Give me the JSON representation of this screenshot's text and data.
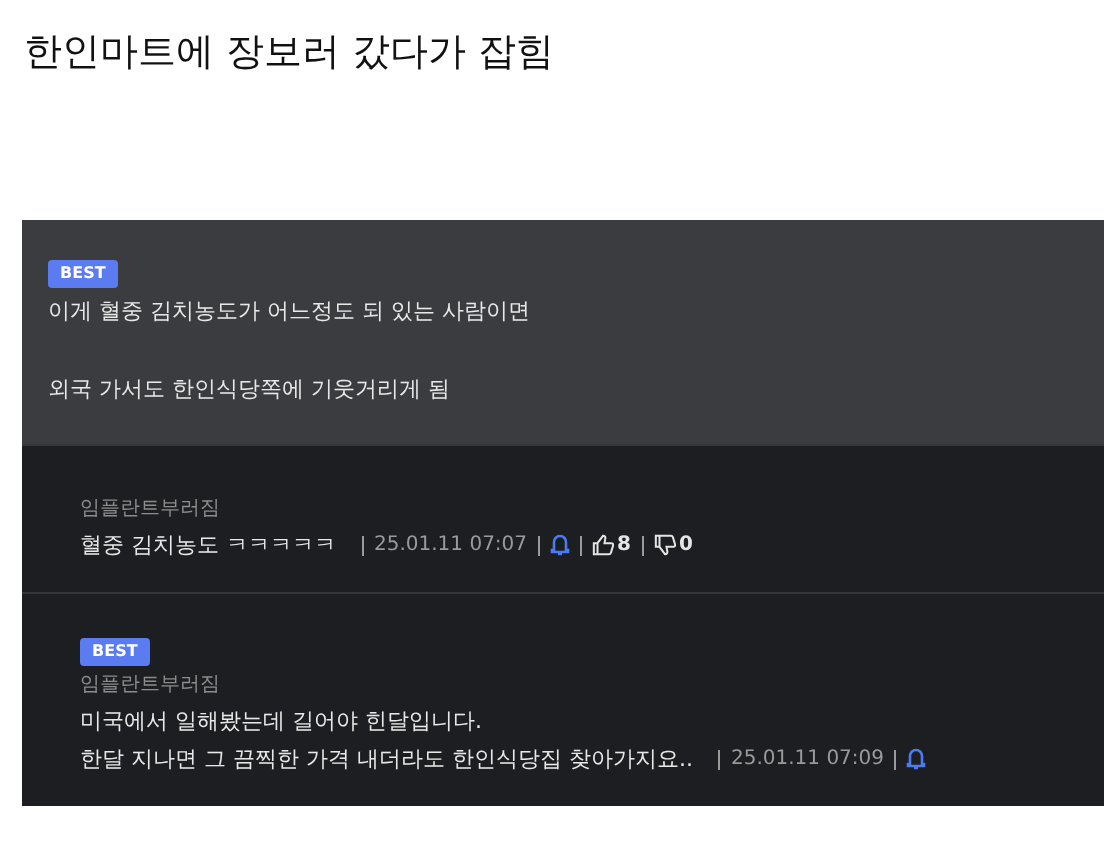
{
  "title": "한인마트에 장보러 갔다가 잡힘",
  "comments": [
    {
      "kind": "top",
      "badge": "BEST",
      "lines": [
        "이게 혈중 김치농도가 어느정도 되 있는 사람이면",
        "외국 가서도 한인식당쪽에 기웃거리게 됨"
      ]
    },
    {
      "kind": "reply",
      "author": "임플란트부러짐",
      "lines": [
        "혈중 김치농도 ㅋㅋㅋㅋㅋ"
      ],
      "date": "25.01.11 07:07",
      "likes": "8",
      "dislikes": "0"
    },
    {
      "kind": "reply",
      "badge": "BEST",
      "author": "임플란트부러짐",
      "lines": [
        "미국에서 일해봤는데 길어야 힌달입니다.",
        "한달 지나면 그 끔찍한 가격 내더라도 한인식당집 찾아가지요.."
      ],
      "date": "25.01.11 07:09"
    }
  ]
}
